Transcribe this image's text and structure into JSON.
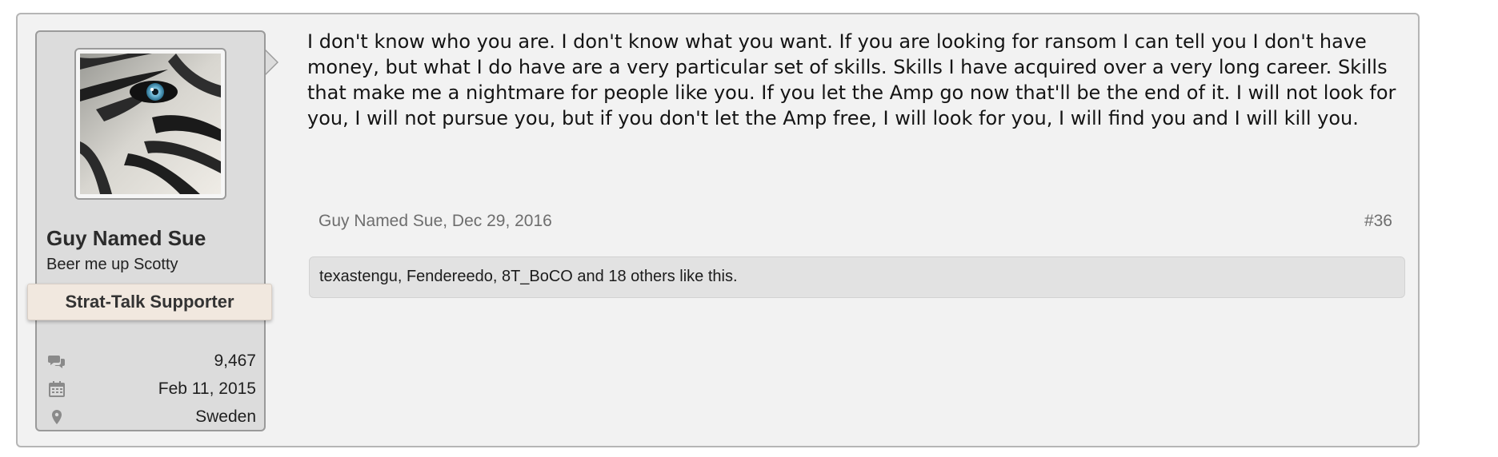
{
  "user": {
    "avatar_icon": "tiger-eye-avatar",
    "name": "Guy Named Sue",
    "title": "Beer me up Scotty",
    "banner": "Strat-Talk Supporter",
    "stats": {
      "messages": {
        "icon": "speech-bubbles-icon",
        "value": "9,467"
      },
      "joined": {
        "icon": "calendar-icon",
        "value": "Feb 11, 2015"
      },
      "location": {
        "icon": "map-pin-icon",
        "value": "Sweden"
      }
    }
  },
  "post": {
    "message": "I don't know who you are. I don't know what you want. If you are looking for ransom I can tell you I don't have money, but what I do have are a very particular set of skills. Skills I have acquired over a very long career. Skills that make me a nightmare for people like you. If you let the Amp go now that'll be the end of it. I will not look for you, I will not pursue you, but if you don't let the Amp free, I will look for you, I will find you and I will kill you.",
    "author_date": "Guy Named Sue, Dec 29, 2016",
    "number": "#36",
    "likes": "texastengu, Fendereedo, 8T_BoCO and 18 others like this."
  },
  "colors": {
    "post_bg": "#f2f2f2",
    "user_panel_bg": "#dcdcdc",
    "banner_bg": "#f1e8df",
    "likes_bg": "#e2e2e2",
    "meta_text": "#6e6e6e"
  }
}
